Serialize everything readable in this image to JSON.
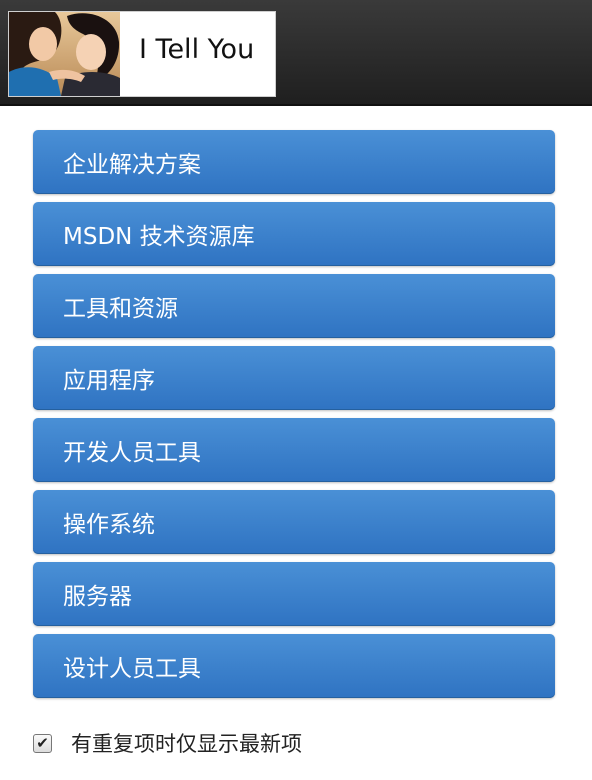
{
  "header": {
    "logo_title": "I Tell You",
    "logo_photo": "two-women-photo"
  },
  "menu": {
    "items": [
      {
        "label": "企业解决方案"
      },
      {
        "label": "MSDN 技术资源库"
      },
      {
        "label": "工具和资源"
      },
      {
        "label": "应用程序"
      },
      {
        "label": "开发人员工具"
      },
      {
        "label": "操作系统"
      },
      {
        "label": "服务器"
      },
      {
        "label": "设计人员工具"
      }
    ]
  },
  "option": {
    "checked": true,
    "label": "有重复项时仅显示最新项"
  },
  "colors": {
    "menu_button": "#3a82cc",
    "header_bg": "#2b2b2b"
  }
}
